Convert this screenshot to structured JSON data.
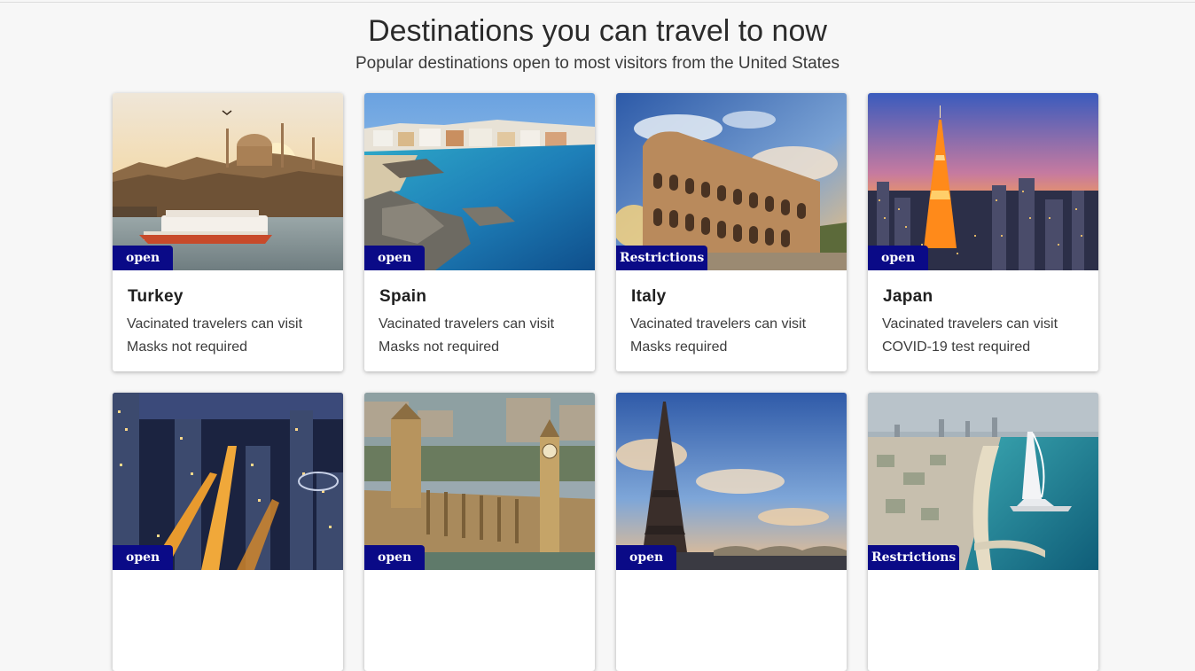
{
  "header": {
    "title": "Destinations you can travel to now",
    "subtitle": "Popular destinations open to most visitors from the United States"
  },
  "destinations": [
    {
      "name": "Turkey",
      "status": "open",
      "line1": "Vacinated travelers can visit",
      "line2": "Masks not required",
      "image_icon": "istanbul-mosque-image"
    },
    {
      "name": "Spain",
      "status": "open",
      "line1": "Vacinated travelers can visit",
      "line2": "Masks not required",
      "image_icon": "spain-coast-image"
    },
    {
      "name": "Italy",
      "status": "Restrictions",
      "line1": "Vacinated travelers can visit",
      "line2": "Masks required",
      "image_icon": "colosseum-image"
    },
    {
      "name": "Japan",
      "status": "open",
      "line1": "Vacinated travelers can visit",
      "line2": "COVID-19 test required",
      "image_icon": "tokyo-tower-image"
    },
    {
      "name": "",
      "status": "open",
      "line1": "",
      "line2": "",
      "image_icon": "city-night-image"
    },
    {
      "name": "",
      "status": "open",
      "line1": "",
      "line2": "",
      "image_icon": "london-parliament-image"
    },
    {
      "name": "",
      "status": "open",
      "line1": "",
      "line2": "",
      "image_icon": "eiffel-tower-image"
    },
    {
      "name": "",
      "status": "Restrictions",
      "line1": "",
      "line2": "",
      "image_icon": "dubai-burj-al-arab-image"
    }
  ],
  "colors": {
    "badge": "#0a0a87",
    "background": "#f7f7f7",
    "card": "#ffffff"
  }
}
